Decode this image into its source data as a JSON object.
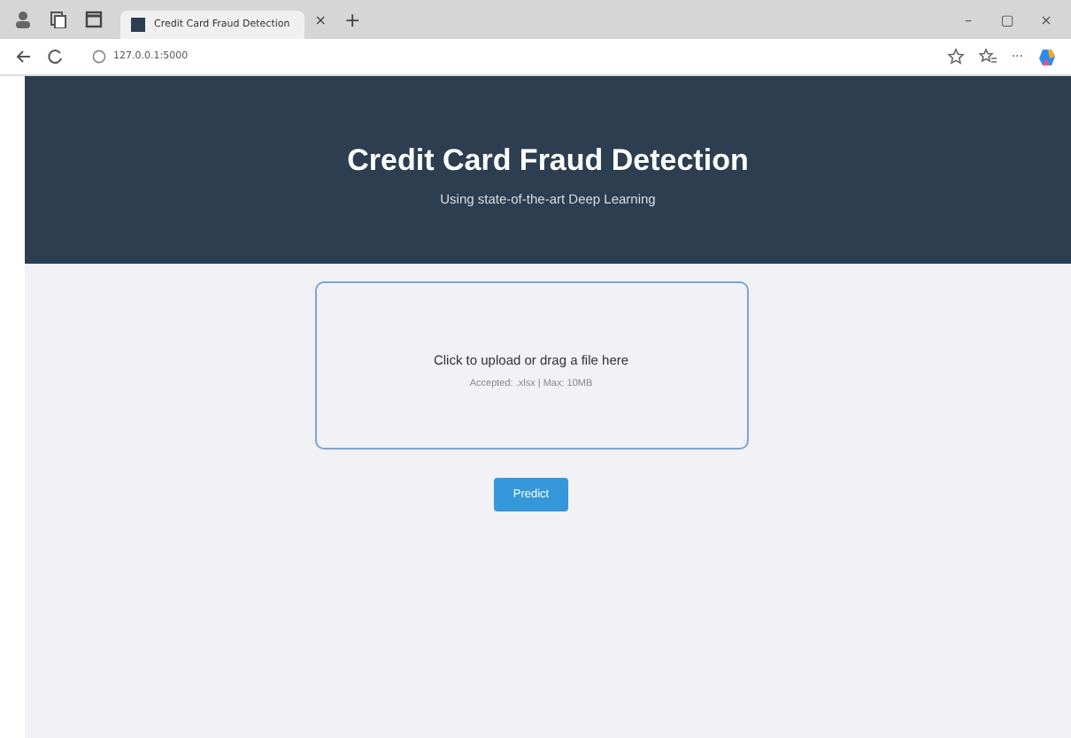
{
  "browser": {
    "tab": {
      "title": "Credit Card Fraud Detection",
      "selected": true
    },
    "tab_close": "×",
    "new_tab": "+",
    "window_controls": [
      "–",
      "▢",
      "×"
    ],
    "address": "127.0.0.1:5000",
    "menu": "···"
  },
  "header": {
    "title": "Credit Card Fraud Detection",
    "subtitle": "Using state-of-the-art Deep Learning"
  },
  "upload": {
    "prompt": "Click to upload or drag a file here",
    "hint": "Accepted: .xlsx | Max: 10MB"
  },
  "button": "Predict"
}
